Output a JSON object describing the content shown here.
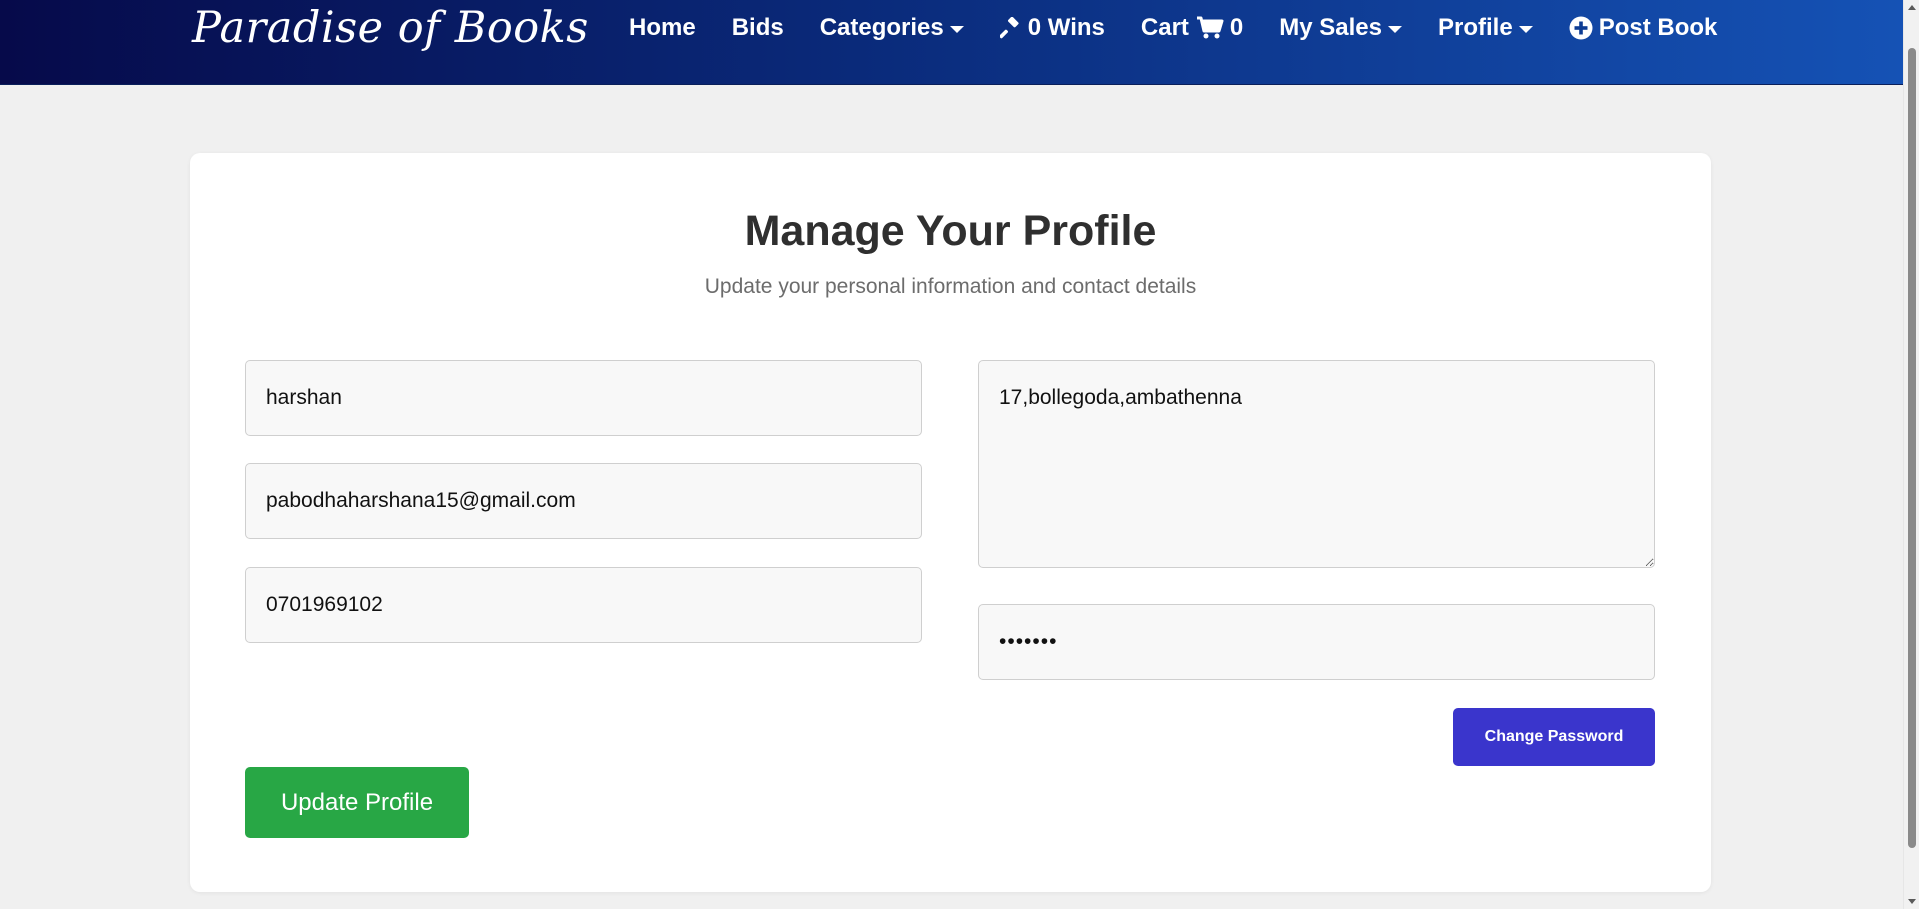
{
  "colors": {
    "navbar_start": "#060a4a",
    "navbar_end": "#1552b5",
    "change_password_button": "#3a35cc",
    "update_profile_button": "#28a745",
    "page_background": "#f0f0f0"
  },
  "navbar": {
    "brand": "Paradise of Books",
    "items": {
      "home": {
        "label": "Home"
      },
      "bids": {
        "label": "Bids"
      },
      "categories": {
        "label": "Categories",
        "icon": "caret-down-icon"
      },
      "wins": {
        "label": "0 Wins",
        "icon": "gavel-icon"
      },
      "cart": {
        "label": "Cart",
        "count": "0",
        "icon": "shopping-cart-icon"
      },
      "my_sales": {
        "label": "My Sales",
        "icon": "caret-down-icon"
      },
      "profile": {
        "label": "Profile",
        "icon": "caret-down-icon"
      },
      "post_book": {
        "label": "Post Book",
        "icon": "plus-circle-icon"
      }
    }
  },
  "profile_form": {
    "title": "Manage Your Profile",
    "subtitle": "Update your personal information and contact details",
    "name": "harshan",
    "email": "pabodhaharshana15@gmail.com",
    "phone": "0701969102",
    "address": "17,bollegoda,ambathenna",
    "password": "•••••••",
    "change_password_label": "Change Password",
    "update_profile_label": "Update Profile"
  }
}
